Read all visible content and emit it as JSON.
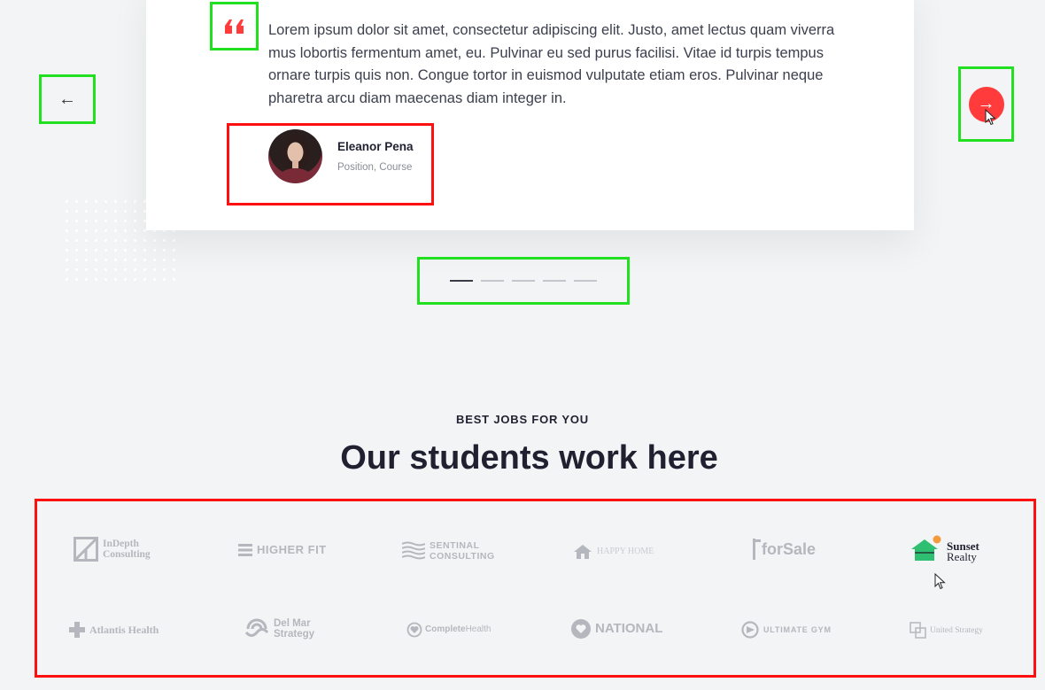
{
  "testimonial": {
    "quote": "Lorem ipsum dolor sit amet, consectetur adipiscing elit. Justo, amet lectus quam viverra mus lobortis fermentum amet, eu. Pulvinar eu sed purus facilisi. Vitae id turpis tempus ornare turpis quis non. Congue tortor in euismod vulputate etiam eros. Pulvinar neque pharetra arcu diam maecenas diam integer in.",
    "author_name": "Eleanor Pena",
    "author_position": "Position, Course"
  },
  "colors": {
    "accent": "#ff3b3b",
    "heading": "#1f2130",
    "logo_gray": "#b4b7bd",
    "sunset_green": "#2fbf71"
  },
  "section": {
    "kicker": "BEST JOBS FOR YOU",
    "title": "Our students work here"
  },
  "logos": {
    "indepth_1": "InDepth",
    "indepth_2": "Consulting",
    "higherfit": "HIGHER FIT",
    "sentinal_1": "SENTINAL",
    "sentinal_2": "CONSULTING",
    "happyhome": "HAPPY HOME",
    "forsale": "forSale",
    "sunset_1": "Sunset",
    "sunset_2": "Realty",
    "atlantis": "Atlantis Health",
    "delmar_1": "Del Mar",
    "delmar_2": "Strategy",
    "complete_a": "Complete",
    "complete_b": "Health",
    "national": "NATIONAL",
    "ultimate": "ULTIMATE GYM",
    "united": "United Strategy"
  }
}
